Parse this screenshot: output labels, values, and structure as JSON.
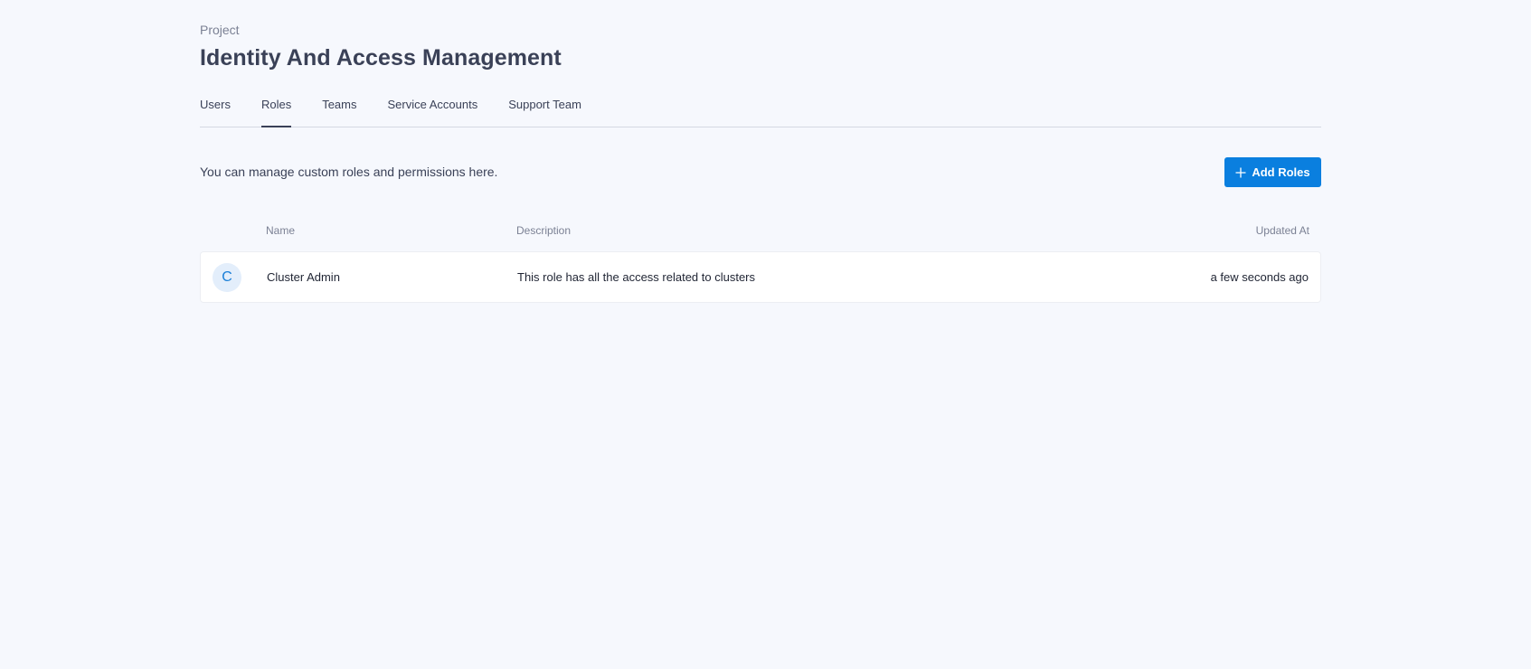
{
  "header": {
    "breadcrumb": "Project",
    "title": "Identity And Access Management"
  },
  "tabs": [
    {
      "label": "Users",
      "active": false
    },
    {
      "label": "Roles",
      "active": true
    },
    {
      "label": "Teams",
      "active": false
    },
    {
      "label": "Service Accounts",
      "active": false
    },
    {
      "label": "Support Team",
      "active": false
    }
  ],
  "toolbar": {
    "description": "You can manage custom roles and permissions here.",
    "add_label": "Add Roles",
    "add_icon": "plus-icon"
  },
  "table": {
    "columns": {
      "name": "Name",
      "description": "Description",
      "updated_at": "Updated At"
    },
    "rows": [
      {
        "initial": "C",
        "name": "Cluster Admin",
        "description": "This role has all the access related to clusters",
        "updated_at": "a few seconds ago"
      }
    ]
  },
  "colors": {
    "background": "#f6f8fd",
    "accent": "#0a7fdf",
    "text": "#3a4157",
    "muted": "#7b8194",
    "avatar_bg": "#e3eefb",
    "avatar_text": "#1a7fd8"
  }
}
